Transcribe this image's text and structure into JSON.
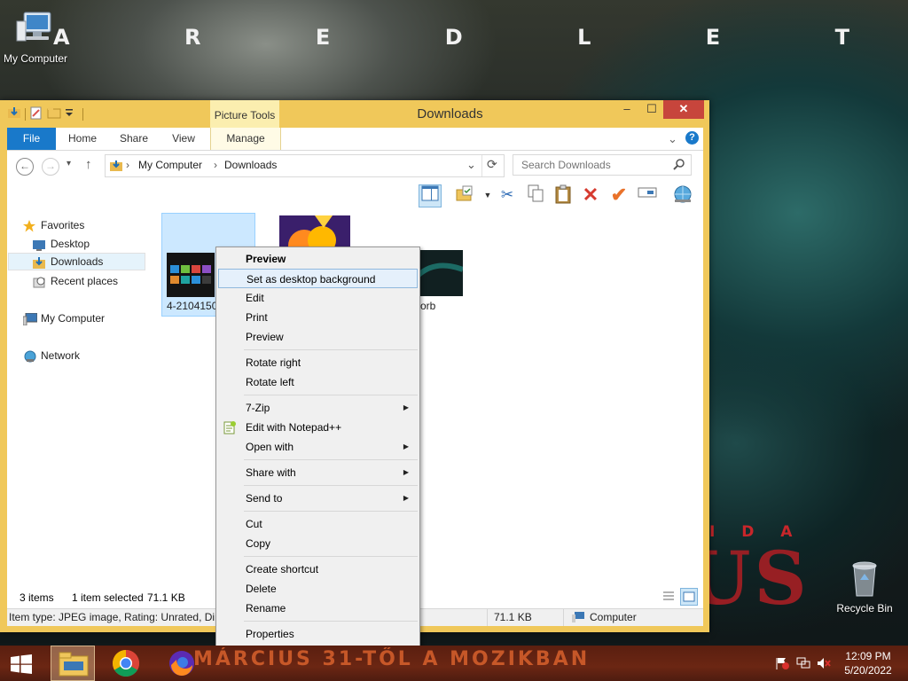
{
  "desktop": {
    "banner_letters": [
      "A",
      "R",
      "E",
      "D",
      "L",
      "E",
      "T"
    ],
    "poster_line_1": "I D A",
    "poster_line_2": "US",
    "icons": {
      "my_computer": "My Computer",
      "recycle_bin": "Recycle Bin"
    }
  },
  "window": {
    "title": "Downloads",
    "contextual_tab_group": "Picture Tools",
    "controls": {
      "minimize": "–",
      "maximize": "☐",
      "close": "✕"
    },
    "ribbon_tabs": [
      "File",
      "Home",
      "Share",
      "View",
      "Manage"
    ],
    "ribbon_expand": "⌄",
    "help": "?",
    "nav": {
      "back": "←",
      "forward": "→",
      "recent": "▾",
      "up": "↑"
    },
    "address": {
      "breadcrumbs": [
        "My Computer",
        "Downloads"
      ],
      "separator": "›",
      "dropdown": "⌄",
      "refresh": "⟳"
    },
    "search": {
      "placeholder": "Search Downloads",
      "icon": "magnifier-icon"
    },
    "nav_pane": {
      "favorites": "Favorites",
      "items": [
        "Desktop",
        "Downloads",
        "Recent places"
      ],
      "my_computer": "My Computer",
      "network": "Network"
    },
    "files": [
      {
        "name": "4-2104150",
        "selected": true
      },
      {
        "name": "",
        "selected": false
      },
      {
        "name": "orb",
        "selected": false
      }
    ],
    "status": {
      "count": "3 items",
      "selection": "1 item selected",
      "size": "71.1 KB",
      "bar_details": "Item type: JPEG image, Rating: Unrated, Dim",
      "bar_size": "71.1 KB",
      "bar_location": "Computer"
    }
  },
  "context_menu": {
    "items": [
      {
        "label": "Preview",
        "bold": true
      },
      {
        "label": "Set as desktop background",
        "hover": true
      },
      {
        "label": "Edit"
      },
      {
        "label": "Print"
      },
      {
        "label": "Preview"
      },
      {
        "label": "Rotate right"
      },
      {
        "label": "Rotate left"
      },
      {
        "label": "7-Zip",
        "submenu": true
      },
      {
        "label": "Edit with Notepad++",
        "icon": "notepad-plus-plus-icon"
      },
      {
        "label": "Open with",
        "submenu": true
      },
      {
        "label": "Share with",
        "submenu": true
      },
      {
        "label": "Send to",
        "submenu": true
      },
      {
        "label": "Cut"
      },
      {
        "label": "Copy"
      },
      {
        "label": "Create shortcut"
      },
      {
        "label": "Delete"
      },
      {
        "label": "Rename"
      },
      {
        "label": "Properties"
      }
    ],
    "submenu_arrow": "▶"
  },
  "taskbar": {
    "banner_text": "MÁRCIUS 31-TŐL A MOZIKBAN",
    "clock": {
      "time": "12:09 PM",
      "date": "5/20/2022"
    }
  },
  "colors": {
    "window_frame": "#f0c85a",
    "file_tab": "#1979ca",
    "close_button": "#c7453c",
    "menu_hover": "#e5f0fb"
  }
}
